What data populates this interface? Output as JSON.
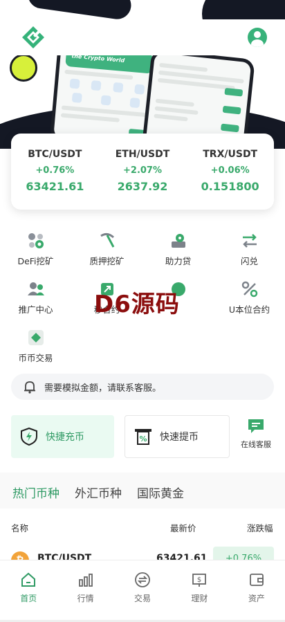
{
  "hero": {
    "phone_banner_text": "the Crypto World"
  },
  "ticker": [
    {
      "pair": "BTC/USDT",
      "change": "+0.76%",
      "price": "63421.61"
    },
    {
      "pair": "ETH/USDT",
      "change": "+2.07%",
      "price": "2637.92"
    },
    {
      "pair": "TRX/USDT",
      "change": "+0.06%",
      "price": "0.151800"
    }
  ],
  "menu": [
    {
      "label": "DeFi挖矿",
      "icon": "defi-mining-icon"
    },
    {
      "label": "质押挖矿",
      "icon": "pickaxe-icon"
    },
    {
      "label": "助力贷",
      "icon": "loan-icon"
    },
    {
      "label": "闪兑",
      "icon": "swap-arrows-icon"
    },
    {
      "label": "推广中心",
      "icon": "referral-icon"
    },
    {
      "label": "秒合约",
      "icon": "seconds-contract-icon"
    },
    {
      "label": "",
      "icon": "hidden-icon"
    },
    {
      "label": "U本位合约",
      "icon": "percent-icon"
    },
    {
      "label": "币币交易",
      "icon": "spot-trade-icon"
    }
  ],
  "watermark": "D6源码",
  "notice": {
    "text": "需要模拟金额，请联系客服。"
  },
  "quick": {
    "deposit": "快捷充币",
    "withdraw": "快速提币",
    "support": "在线客服"
  },
  "market": {
    "tabs": [
      "热门币种",
      "外汇币种",
      "国际黄金"
    ],
    "headers": {
      "name": "名称",
      "price": "最新价",
      "change": "涨跌幅"
    },
    "rows": [
      {
        "coin_symbol": "₿",
        "name": "BTC/USDT",
        "price": "63421.61",
        "change": "+0.76%"
      }
    ]
  },
  "nav": [
    {
      "label": "首页",
      "icon": "home-icon",
      "active": true
    },
    {
      "label": "行情",
      "icon": "chart-icon",
      "active": false
    },
    {
      "label": "交易",
      "icon": "trade-icon",
      "active": false
    },
    {
      "label": "理财",
      "icon": "finance-icon",
      "active": false
    },
    {
      "label": "资产",
      "icon": "wallet-icon",
      "active": false
    }
  ],
  "colors": {
    "accent": "#2f9a64",
    "up": "#39a96b",
    "dark": "#141824"
  }
}
